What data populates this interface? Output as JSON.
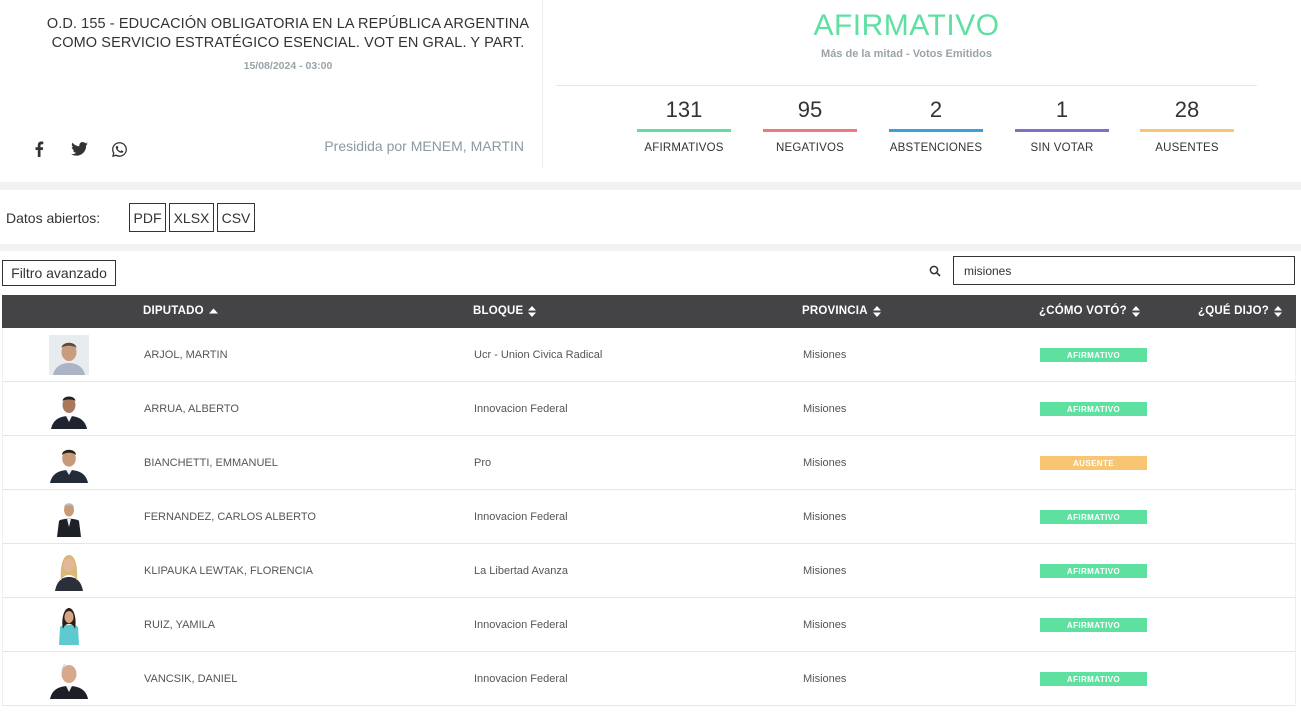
{
  "header": {
    "title": "O.D. 155 - EDUCACIÓN OBLIGATORIA EN LA REPÚBLICA ARGENTINA COMO SERVICIO ESTRATÉGICO ESENCIAL. VOT EN GRAL. Y PART.",
    "date": "15/08/2024 - 03:00",
    "presided_by": "Presidida por MENEM, MARTIN",
    "social_icons": [
      "facebook-icon",
      "twitter-icon",
      "whatsapp-icon"
    ]
  },
  "result": {
    "label": "AFIRMATIVO",
    "subtitle": "Más de la mitad - Votos Emitidos",
    "color": "#5ee0a0"
  },
  "stats": [
    {
      "value": "131",
      "label": "AFIRMATIVOS",
      "color": "#5ee0a0"
    },
    {
      "value": "95",
      "label": "NEGATIVOS",
      "color": "#f07878"
    },
    {
      "value": "2",
      "label": "ABSTENCIONES",
      "color": "#3aa2d8"
    },
    {
      "value": "1",
      "label": "SIN VOTAR",
      "color": "#7a72c6"
    },
    {
      "value": "28",
      "label": "AUSENTES",
      "color": "#f8c572"
    }
  ],
  "open_data": {
    "label": "Datos abiertos:",
    "buttons": [
      "PDF",
      "XLSX",
      "CSV"
    ]
  },
  "filter": {
    "button_label": "Filtro avanzado",
    "search_value": "misiones"
  },
  "table": {
    "columns": [
      "DIPUTADO",
      "BLOQUE",
      "PROVINCIA",
      "¿CÓMO VOTÓ?",
      "¿QUÉ DIJO?"
    ],
    "rows": [
      {
        "name": "ARJOL, MARTIN",
        "bloque": "Ucr - Union Civica Radical",
        "provincia": "Misiones",
        "voto": "AFIRMATIVO",
        "voto_color": "#5ee0a0"
      },
      {
        "name": "ARRUA, ALBERTO",
        "bloque": "Innovacion Federal",
        "provincia": "Misiones",
        "voto": "AFIRMATIVO",
        "voto_color": "#5ee0a0"
      },
      {
        "name": "BIANCHETTI, EMMANUEL",
        "bloque": "Pro",
        "provincia": "Misiones",
        "voto": "AUSENTE",
        "voto_color": "#f8c572"
      },
      {
        "name": "FERNANDEZ, CARLOS ALBERTO",
        "bloque": "Innovacion Federal",
        "provincia": "Misiones",
        "voto": "AFIRMATIVO",
        "voto_color": "#5ee0a0"
      },
      {
        "name": "KLIPAUKA LEWTAK, FLORENCIA",
        "bloque": "La Libertad Avanza",
        "provincia": "Misiones",
        "voto": "AFIRMATIVO",
        "voto_color": "#5ee0a0"
      },
      {
        "name": "RUIZ, YAMILA",
        "bloque": "Innovacion Federal",
        "provincia": "Misiones",
        "voto": "AFIRMATIVO",
        "voto_color": "#5ee0a0"
      },
      {
        "name": "VANCSIK, DANIEL",
        "bloque": "Innovacion Federal",
        "provincia": "Misiones",
        "voto": "AFIRMATIVO",
        "voto_color": "#5ee0a0"
      }
    ]
  }
}
